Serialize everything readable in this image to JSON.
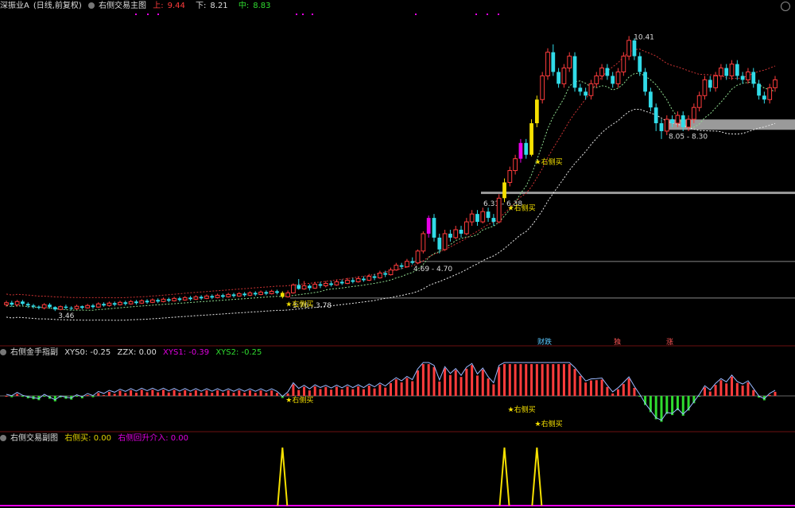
{
  "main_header": {
    "stock": "深振业A",
    "period": "(日线,前复权)",
    "indicator": "右侧交易主图",
    "upper_label": "上:",
    "upper_value": "9.44",
    "lower_label": "下:",
    "lower_value": "8.21",
    "mid_label": "中:",
    "mid_value": "8.83"
  },
  "sub1_header": {
    "title": "右侧金手指副",
    "xys0": "XYS0: -0.25",
    "zzx": "ZZX: 0.00",
    "xys1": "XYS1: -0.39",
    "xys2": "XYS2: -0.25"
  },
  "sub2_header": {
    "title": "右侧交易副图",
    "buy": "右侧买: 0.00",
    "dip": "右侧回升介入: 0.00"
  },
  "colors": {
    "up": "#ff3c3c",
    "down": "#31dbe8",
    "signal_yellow": "#f5e000",
    "signal_magenta": "#e800e8",
    "grid_red": "#6b1010"
  },
  "chart_data": {
    "type": "candlestick",
    "ylim": [
      2.9,
      10.8
    ],
    "price_levels": [
      {
        "label": "3.76 - 3.78",
        "value": 3.77
      },
      {
        "label": "4.69 - 4.70",
        "value": 4.695
      },
      {
        "label": "6.31 - 6.38",
        "value": 6.345
      },
      {
        "label": "8.05 - 8.30",
        "value": 8.175
      }
    ],
    "annotations": {
      "high": "10.41",
      "low": "3.46",
      "buy_signal": "★右侧买",
      "events": [
        "财跌",
        "独",
        "涨"
      ]
    },
    "candles": [
      [
        3.6,
        3.65,
        3.7,
        3.55
      ],
      [
        3.65,
        3.6,
        3.7,
        3.55
      ],
      [
        3.6,
        3.68,
        3.72,
        3.55
      ],
      [
        3.68,
        3.62,
        3.72,
        3.58
      ],
      [
        3.62,
        3.58,
        3.66,
        3.52
      ],
      [
        3.58,
        3.55,
        3.62,
        3.5
      ],
      [
        3.55,
        3.52,
        3.58,
        3.48
      ],
      [
        3.52,
        3.6,
        3.64,
        3.48
      ],
      [
        3.6,
        3.54,
        3.64,
        3.5
      ],
      [
        3.54,
        3.48,
        3.56,
        3.44
      ],
      [
        3.48,
        3.55,
        3.58,
        3.46
      ],
      [
        3.55,
        3.52,
        3.6,
        3.48
      ],
      [
        3.52,
        3.5,
        3.56,
        3.46
      ],
      [
        3.5,
        3.56,
        3.6,
        3.47
      ],
      [
        3.56,
        3.52,
        3.58,
        3.48
      ],
      [
        3.52,
        3.58,
        3.62,
        3.5
      ],
      [
        3.58,
        3.54,
        3.62,
        3.5
      ],
      [
        3.54,
        3.62,
        3.66,
        3.52
      ],
      [
        3.62,
        3.58,
        3.66,
        3.55
      ],
      [
        3.58,
        3.64,
        3.68,
        3.55
      ],
      [
        3.64,
        3.6,
        3.68,
        3.56
      ],
      [
        3.6,
        3.66,
        3.7,
        3.58
      ],
      [
        3.66,
        3.62,
        3.7,
        3.58
      ],
      [
        3.62,
        3.68,
        3.72,
        3.6
      ],
      [
        3.68,
        3.64,
        3.72,
        3.6
      ],
      [
        3.64,
        3.7,
        3.74,
        3.62
      ],
      [
        3.7,
        3.66,
        3.74,
        3.62
      ],
      [
        3.66,
        3.72,
        3.76,
        3.64
      ],
      [
        3.72,
        3.68,
        3.76,
        3.64
      ],
      [
        3.68,
        3.74,
        3.78,
        3.66
      ],
      [
        3.74,
        3.7,
        3.78,
        3.66
      ],
      [
        3.7,
        3.76,
        3.8,
        3.68
      ],
      [
        3.76,
        3.72,
        3.8,
        3.68
      ],
      [
        3.72,
        3.78,
        3.82,
        3.7
      ],
      [
        3.78,
        3.74,
        3.82,
        3.7
      ],
      [
        3.74,
        3.8,
        3.84,
        3.72
      ],
      [
        3.8,
        3.76,
        3.84,
        3.72
      ],
      [
        3.76,
        3.82,
        3.86,
        3.74
      ],
      [
        3.82,
        3.78,
        3.86,
        3.74
      ],
      [
        3.78,
        3.84,
        3.88,
        3.76
      ],
      [
        3.84,
        3.8,
        3.88,
        3.76
      ],
      [
        3.8,
        3.86,
        3.9,
        3.78
      ],
      [
        3.86,
        3.82,
        3.9,
        3.78
      ],
      [
        3.82,
        3.88,
        3.92,
        3.8
      ],
      [
        3.88,
        3.84,
        3.92,
        3.8
      ],
      [
        3.84,
        3.9,
        3.94,
        3.82
      ],
      [
        3.9,
        3.86,
        3.94,
        3.82
      ],
      [
        3.86,
        3.92,
        3.96,
        3.84
      ],
      [
        3.92,
        3.88,
        3.96,
        3.84
      ],
      [
        3.88,
        3.94,
        3.98,
        3.86
      ],
      [
        3.94,
        3.9,
        3.98,
        3.86
      ],
      [
        3.9,
        3.8,
        3.94,
        3.76
      ],
      [
        3.8,
        3.9,
        3.96,
        3.78
      ],
      [
        3.9,
        4.1,
        4.14,
        3.88
      ],
      [
        4.1,
        4.0,
        4.25,
        3.98
      ],
      [
        4.0,
        4.08,
        4.2,
        3.98
      ],
      [
        4.08,
        4.02,
        4.12,
        3.96
      ],
      [
        4.02,
        4.12,
        4.18,
        4.0
      ],
      [
        4.12,
        4.08,
        4.18,
        4.02
      ],
      [
        4.08,
        4.14,
        4.2,
        4.04
      ],
      [
        4.14,
        4.1,
        4.2,
        4.06
      ],
      [
        4.1,
        4.18,
        4.24,
        4.08
      ],
      [
        4.18,
        4.14,
        4.24,
        4.1
      ],
      [
        4.14,
        4.22,
        4.28,
        4.12
      ],
      [
        4.22,
        4.18,
        4.28,
        4.14
      ],
      [
        4.18,
        4.26,
        4.32,
        4.16
      ],
      [
        4.26,
        4.22,
        4.32,
        4.18
      ],
      [
        4.22,
        4.32,
        4.38,
        4.2
      ],
      [
        4.32,
        4.28,
        4.38,
        4.22
      ],
      [
        4.28,
        4.4,
        4.46,
        4.26
      ],
      [
        4.4,
        4.36,
        4.46,
        4.3
      ],
      [
        4.36,
        4.48,
        4.54,
        4.34
      ],
      [
        4.48,
        4.6,
        4.66,
        4.46
      ],
      [
        4.6,
        4.56,
        4.66,
        4.5
      ],
      [
        4.56,
        4.7,
        4.76,
        4.54
      ],
      [
        4.7,
        4.66,
        4.8,
        4.62
      ],
      [
        4.66,
        4.96,
        5.0,
        4.64
      ],
      [
        4.96,
        5.4,
        5.46,
        4.9
      ],
      [
        5.4,
        5.8,
        5.86,
        5.3
      ],
      [
        5.8,
        5.3,
        5.9,
        5.2
      ],
      [
        5.3,
        5.0,
        5.4,
        4.9
      ],
      [
        5.0,
        5.4,
        5.5,
        4.96
      ],
      [
        5.4,
        5.3,
        5.5,
        5.2
      ],
      [
        5.3,
        5.5,
        5.6,
        5.26
      ],
      [
        5.5,
        5.4,
        5.6,
        5.3
      ],
      [
        5.4,
        5.7,
        5.8,
        5.36
      ],
      [
        5.7,
        5.9,
        6.0,
        5.6
      ],
      [
        5.9,
        5.7,
        6.0,
        5.6
      ],
      [
        5.7,
        5.96,
        6.06,
        5.66
      ],
      [
        5.96,
        5.8,
        6.06,
        5.7
      ],
      [
        5.8,
        5.7,
        5.9,
        5.6
      ],
      [
        5.7,
        6.3,
        6.4,
        5.66
      ],
      [
        6.3,
        6.7,
        6.8,
        6.2
      ],
      [
        6.7,
        7.0,
        7.1,
        6.6
      ],
      [
        7.0,
        7.3,
        7.4,
        6.9
      ],
      [
        7.3,
        7.7,
        7.8,
        7.2
      ],
      [
        7.7,
        7.4,
        7.8,
        7.3
      ],
      [
        7.4,
        8.2,
        8.3,
        7.36
      ],
      [
        8.2,
        8.8,
        8.9,
        8.1
      ],
      [
        8.8,
        9.4,
        9.5,
        8.7
      ],
      [
        9.4,
        10.0,
        10.1,
        9.3
      ],
      [
        10.0,
        9.5,
        10.2,
        9.4
      ],
      [
        9.5,
        9.2,
        9.6,
        9.1
      ],
      [
        9.2,
        9.6,
        9.7,
        9.1
      ],
      [
        9.6,
        9.9,
        10.0,
        9.5
      ],
      [
        9.9,
        9.1,
        10.0,
        9.0
      ],
      [
        9.1,
        9.0,
        9.2,
        8.9
      ],
      [
        9.0,
        8.9,
        9.1,
        8.8
      ],
      [
        8.9,
        9.2,
        9.3,
        8.8
      ],
      [
        9.2,
        9.4,
        9.5,
        9.1
      ],
      [
        9.4,
        9.6,
        9.7,
        9.3
      ],
      [
        9.6,
        9.4,
        9.7,
        9.3
      ],
      [
        9.4,
        9.2,
        9.5,
        9.1
      ],
      [
        9.2,
        9.5,
        9.6,
        9.1
      ],
      [
        9.5,
        9.9,
        10.0,
        9.4
      ],
      [
        9.9,
        10.3,
        10.41,
        9.8
      ],
      [
        10.3,
        9.9,
        10.35,
        9.8
      ],
      [
        9.9,
        9.5,
        10.0,
        9.4
      ],
      [
        9.5,
        9.0,
        9.6,
        8.9
      ],
      [
        9.0,
        8.6,
        9.1,
        8.5
      ],
      [
        8.6,
        8.2,
        8.7,
        8.0
      ],
      [
        8.2,
        8.0,
        8.3,
        7.8
      ],
      [
        8.0,
        8.3,
        8.4,
        7.9
      ],
      [
        8.3,
        8.2,
        8.4,
        8.1
      ],
      [
        8.2,
        8.4,
        8.5,
        8.1
      ],
      [
        8.4,
        8.1,
        8.5,
        8.0
      ],
      [
        8.1,
        8.3,
        8.4,
        8.0
      ],
      [
        8.3,
        8.6,
        8.7,
        8.2
      ],
      [
        8.6,
        8.9,
        9.0,
        8.5
      ],
      [
        8.9,
        9.3,
        9.4,
        8.8
      ],
      [
        9.3,
        9.1,
        9.4,
        9.0
      ],
      [
        9.1,
        9.4,
        9.5,
        9.0
      ],
      [
        9.4,
        9.6,
        9.7,
        9.3
      ],
      [
        9.6,
        9.4,
        9.7,
        9.3
      ],
      [
        9.4,
        9.7,
        9.8,
        9.3
      ],
      [
        9.7,
        9.4,
        9.8,
        9.3
      ],
      [
        9.4,
        9.3,
        9.5,
        9.2
      ],
      [
        9.3,
        9.5,
        9.6,
        9.2
      ],
      [
        9.5,
        9.2,
        9.6,
        9.1
      ],
      [
        9.2,
        8.9,
        9.3,
        8.8
      ],
      [
        8.9,
        8.8,
        9.0,
        8.7
      ],
      [
        8.8,
        9.1,
        9.2,
        8.7
      ],
      [
        9.1,
        9.3,
        9.4,
        9.0
      ]
    ],
    "buy_signal_indices": [
      51,
      92,
      97,
      98
    ]
  }
}
